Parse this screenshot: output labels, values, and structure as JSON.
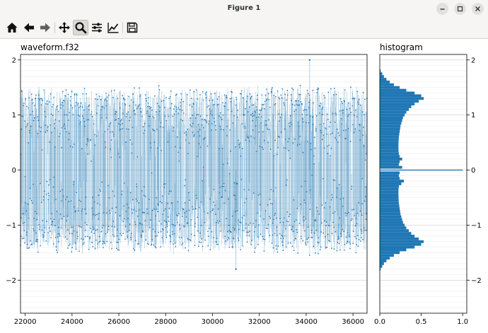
{
  "window": {
    "title": "Figure 1"
  },
  "toolbar": {
    "buttons": [
      {
        "name": "home-button",
        "icon": "home-icon"
      },
      {
        "name": "back-button",
        "icon": "arrow-left-icon"
      },
      {
        "name": "forward-button",
        "icon": "arrow-right-icon"
      },
      {
        "name": "pan-button",
        "icon": "move-icon"
      },
      {
        "name": "zoom-button",
        "icon": "magnifier-icon",
        "active": true
      },
      {
        "name": "configure-subplots-button",
        "icon": "sliders-icon"
      },
      {
        "name": "edit-axes-button",
        "icon": "line-chart-icon"
      },
      {
        "name": "save-button",
        "icon": "floppy-disk-icon"
      }
    ]
  },
  "chart_data": [
    {
      "type": "line",
      "title": "waveform.f32",
      "xlabel": "",
      "ylabel": "",
      "xlim": [
        21800,
        36600
      ],
      "ylim": [
        -2.6,
        2.1
      ],
      "xticks": [
        22000,
        24000,
        26000,
        28000,
        30000,
        32000,
        34000,
        36000
      ],
      "yticks": [
        -2,
        -1,
        0,
        1,
        2
      ],
      "grid": "horizontal minor",
      "markers": "small dots",
      "envelope_max_approx": 1.55,
      "envelope_min_approx": -1.55,
      "outliers": [
        {
          "x": 34150,
          "y": 2.0
        },
        {
          "x": 31000,
          "y": -1.8
        }
      ],
      "color": "#1f77b4"
    },
    {
      "type": "bar",
      "orientation": "horizontal",
      "title": "histogram",
      "xlabel": "",
      "ylabel": "",
      "xlim": [
        0,
        1.05
      ],
      "ylim": [
        -2.6,
        2.1
      ],
      "xticks": [
        0.0,
        0.5,
        1.0
      ],
      "xtick_labels": [
        "0.0",
        "0.5",
        "1.0"
      ],
      "yticks": [
        -2,
        -1,
        0,
        1,
        2
      ],
      "bin_width": 0.05,
      "bin_centers": [
        -1.8,
        -1.75,
        -1.7,
        -1.65,
        -1.6,
        -1.55,
        -1.5,
        -1.45,
        -1.4,
        -1.35,
        -1.3,
        -1.25,
        -1.2,
        -1.15,
        -1.1,
        -1.05,
        -1.0,
        -0.95,
        -0.9,
        -0.85,
        -0.8,
        -0.75,
        -0.7,
        -0.65,
        -0.6,
        -0.55,
        -0.5,
        -0.45,
        -0.4,
        -0.35,
        -0.3,
        -0.25,
        -0.2,
        -0.15,
        -0.1,
        -0.05,
        0.0,
        0.05,
        0.1,
        0.15,
        0.2,
        0.25,
        0.3,
        0.35,
        0.4,
        0.45,
        0.5,
        0.55,
        0.6,
        0.65,
        0.7,
        0.75,
        0.8,
        0.85,
        0.9,
        0.95,
        1.0,
        1.05,
        1.1,
        1.15,
        1.2,
        1.25,
        1.3,
        1.35,
        1.4,
        1.45,
        1.5,
        1.55,
        1.6,
        1.65,
        1.7,
        1.75,
        1.8
      ],
      "values": [
        0.01,
        0.03,
        0.05,
        0.08,
        0.12,
        0.17,
        0.24,
        0.32,
        0.42,
        0.5,
        0.53,
        0.47,
        0.42,
        0.38,
        0.35,
        0.32,
        0.3,
        0.28,
        0.27,
        0.26,
        0.25,
        0.245,
        0.24,
        0.235,
        0.23,
        0.228,
        0.226,
        0.225,
        0.225,
        0.226,
        0.23,
        0.26,
        0.29,
        0.24,
        0.23,
        0.24,
        1.0,
        0.27,
        0.23,
        0.24,
        0.27,
        0.24,
        0.23,
        0.226,
        0.225,
        0.225,
        0.226,
        0.228,
        0.23,
        0.235,
        0.24,
        0.245,
        0.25,
        0.26,
        0.27,
        0.28,
        0.3,
        0.32,
        0.35,
        0.38,
        0.42,
        0.47,
        0.53,
        0.5,
        0.42,
        0.32,
        0.24,
        0.17,
        0.12,
        0.08,
        0.05,
        0.03,
        0.01
      ],
      "color": "#1f77b4"
    }
  ]
}
